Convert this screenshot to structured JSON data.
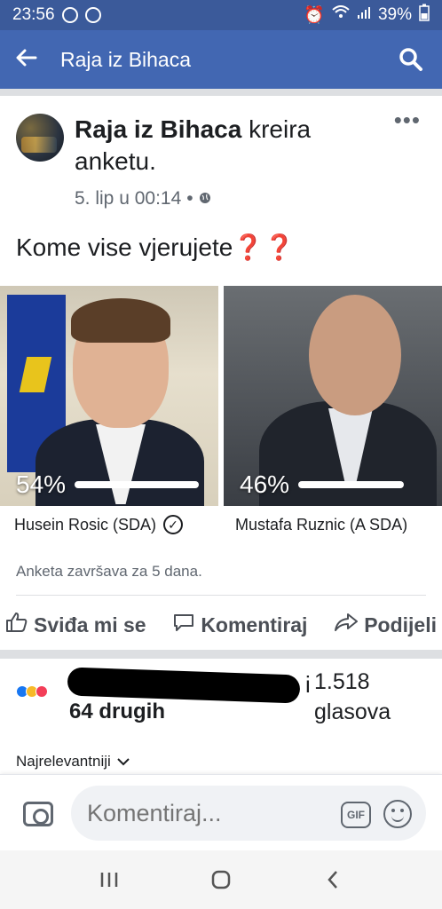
{
  "status_bar": {
    "time": "23:56",
    "battery": "39%"
  },
  "nav": {
    "title": "Raja iz Bihaca"
  },
  "post": {
    "author": "Raja iz Bihaca",
    "action": " kreira anketu.",
    "timestamp": "5. lip u 00:14",
    "separator": "•",
    "question": "Kome vise vjerujete",
    "question_marks": "❓❓"
  },
  "poll": {
    "options": [
      {
        "label": "Husein Rosic (SDA)",
        "percent": "54%",
        "fraction": 0.54,
        "checked": true
      },
      {
        "label": "Mustafa Ruznic (A SDA)",
        "percent": "46%",
        "fraction": 0.46,
        "checked": false
      }
    ],
    "ends_text": "Anketa završava za 5 dana."
  },
  "actions": {
    "like": "Sviđa mi se",
    "comment": "Komentiraj",
    "share": "Podijeli"
  },
  "reactions": {
    "icons": [
      "like-icon",
      "haha-icon",
      "love-icon"
    ],
    "colors": [
      "#1877f2",
      "#f7b928",
      "#f33e58"
    ],
    "reactor_trail": "i",
    "others": "64 drugih",
    "votes_count": "1.518",
    "votes_label": "glasova"
  },
  "sort": {
    "label": "Najrelevantniji"
  },
  "composer": {
    "placeholder": "Komentiraj...",
    "gif": "GIF"
  }
}
